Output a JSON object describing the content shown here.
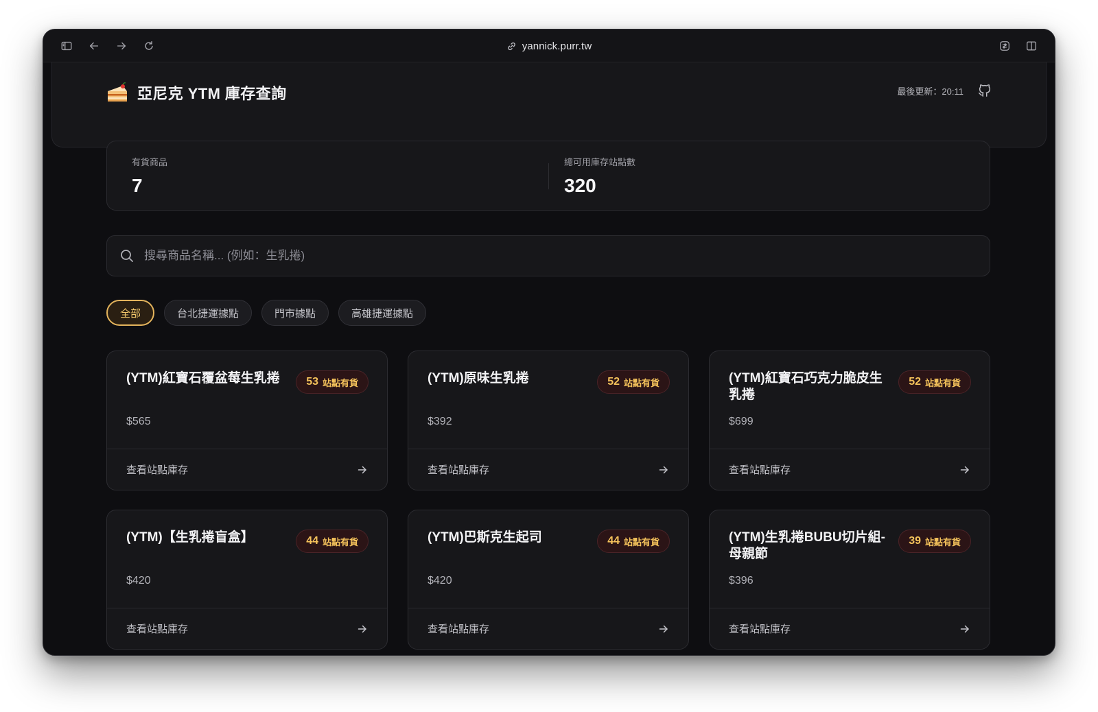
{
  "browser": {
    "url": "yannick.purr.tw"
  },
  "header": {
    "title": "亞尼克 YTM 庫存查詢",
    "updated": "最後更新：20:11"
  },
  "stats": {
    "items_label": "有貨商品",
    "items_value": "7",
    "stations_label": "總可用庫存站點數",
    "stations_value": "320"
  },
  "search": {
    "placeholder": "搜尋商品名稱... (例如：生乳捲)"
  },
  "filters": [
    "全部",
    "台北捷運據點",
    "門市據點",
    "高雄捷運據點"
  ],
  "active_filter": "全部",
  "accent_color": "#f4c25b",
  "cards": [
    {
      "title": "(YTM)紅寶石覆盆莓生乳捲",
      "count": "53",
      "badge_text": "站點有貨",
      "price": "$565",
      "footer": "查看站點庫存"
    },
    {
      "title": "(YTM)原味生乳捲",
      "count": "52",
      "badge_text": "站點有貨",
      "price": "$392",
      "footer": "查看站點庫存"
    },
    {
      "title": "(YTM)紅寶石巧克力脆皮生乳捲",
      "count": "52",
      "badge_text": "站點有貨",
      "price": "$699",
      "footer": "查看站點庫存"
    },
    {
      "title": "(YTM)【生乳捲盲盒】",
      "count": "44",
      "badge_text": "站點有貨",
      "price": "$420",
      "footer": "查看站點庫存"
    },
    {
      "title": "(YTM)巴斯克生起司",
      "count": "44",
      "badge_text": "站點有貨",
      "price": "$420",
      "footer": "查看站點庫存"
    },
    {
      "title": "(YTM)生乳捲BUBU切片組-母親節",
      "count": "39",
      "badge_text": "站點有貨",
      "price": "$396",
      "footer": "查看站點庫存"
    }
  ]
}
